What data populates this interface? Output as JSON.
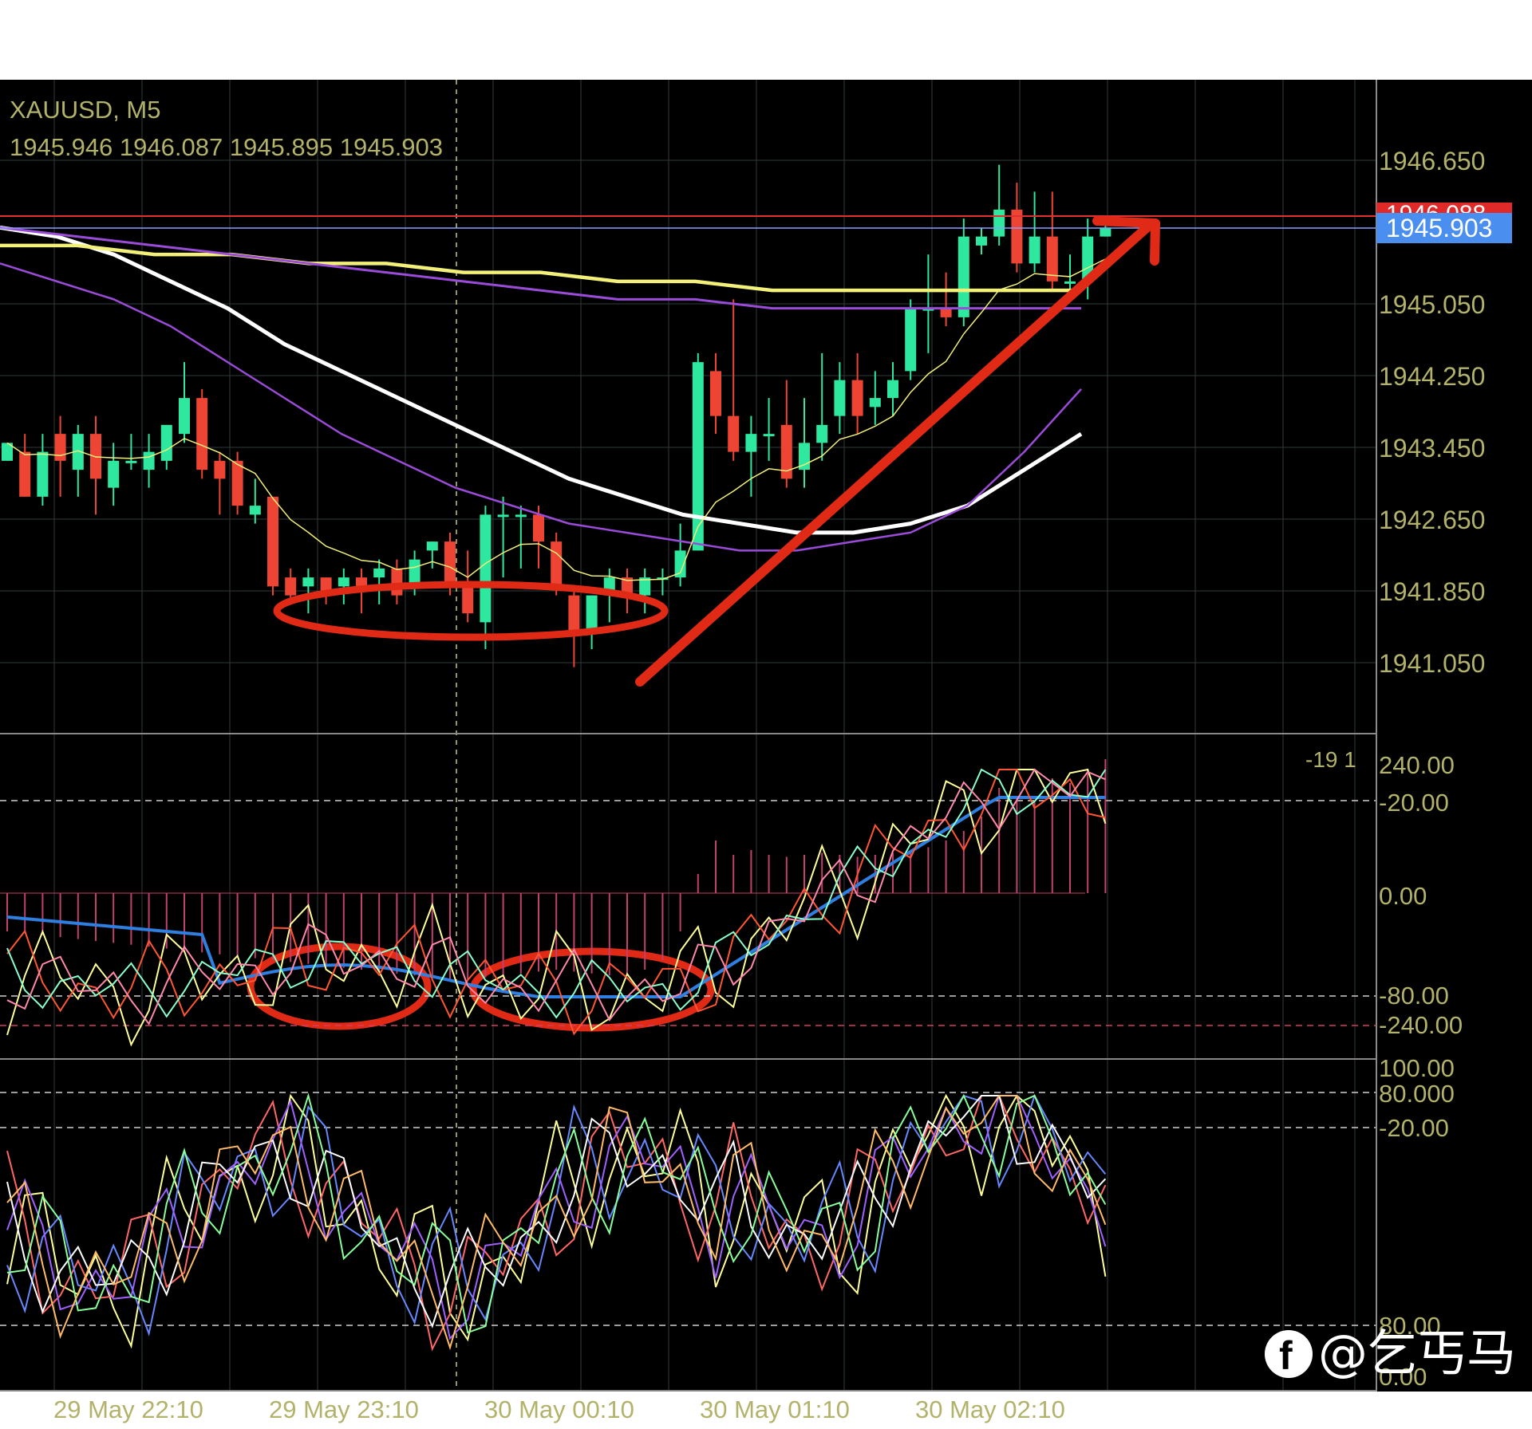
{
  "header": {
    "symbol": "XAUUSD, M5",
    "ohlc": "1945.946 1946.087 1945.895 1945.903"
  },
  "colors": {
    "background": "#000000",
    "grid": "#2f3a3a",
    "axis_text": "#b3b26a",
    "bull": "#2ee8a0",
    "bear": "#ee4433",
    "ask_line": "#e03030",
    "bid_line": "#8aa0ff",
    "price_tag": "#4a8ff0",
    "annotation": "#e02a16",
    "sma_white": "#ffffff",
    "ma_yellow": "#f3f07a",
    "ma_purple": "#9a4bd8",
    "macd_blue": "#2f7fe0"
  },
  "price_tags": {
    "bid": "1945.903",
    "ask_partial": "1946.088"
  },
  "price_axis": {
    "ticks": [
      "1946.650",
      "1945.050",
      "1944.250",
      "1943.450",
      "1942.650",
      "1941.850",
      "1941.050"
    ]
  },
  "osc1_axis": {
    "ticks": [
      "240.00",
      "-20.00",
      "0.00",
      "-80.00",
      "-240.00"
    ],
    "corner_text": "-19 1"
  },
  "osc2_axis": {
    "ticks": [
      "100.00",
      "80.000",
      "-20.00",
      "80.00",
      "0.00"
    ]
  },
  "time_axis": {
    "labels": [
      "29 May 22:10",
      "29 May 23:10",
      "30 May 00:10",
      "30 May 01:10",
      "30 May 02:10"
    ]
  },
  "watermark": {
    "text": "@乞丐马",
    "icon": "facebook-icon"
  },
  "chart_data": {
    "type": "candlestick",
    "title": "XAUUSD, M5",
    "ylim": [
      1940.4,
      1947.2
    ],
    "candles": [
      [
        1943.3,
        1943.5,
        1943.5,
        1943.3
      ],
      [
        1943.4,
        1942.9,
        1943.6,
        1942.9
      ],
      [
        1942.9,
        1943.4,
        1943.6,
        1942.8
      ],
      [
        1943.6,
        1943.3,
        1943.8,
        1942.9
      ],
      [
        1943.2,
        1943.6,
        1943.7,
        1942.9
      ],
      [
        1943.6,
        1943.1,
        1943.8,
        1942.7
      ],
      [
        1943.0,
        1943.3,
        1943.5,
        1942.8
      ],
      [
        1943.3,
        1943.3,
        1943.6,
        1943.2
      ],
      [
        1943.2,
        1943.4,
        1943.6,
        1943.0
      ],
      [
        1943.3,
        1943.7,
        1943.7,
        1943.2
      ],
      [
        1943.6,
        1944.0,
        1944.4,
        1943.5
      ],
      [
        1944.0,
        1943.2,
        1944.1,
        1943.1
      ],
      [
        1943.3,
        1943.1,
        1943.4,
        1942.7
      ],
      [
        1943.3,
        1942.8,
        1943.4,
        1942.7
      ],
      [
        1942.7,
        1942.8,
        1943.1,
        1942.6
      ],
      [
        1942.9,
        1941.9,
        1942.9,
        1941.8
      ],
      [
        1942.0,
        1941.8,
        1942.1,
        1941.7
      ],
      [
        1941.9,
        1942.0,
        1942.1,
        1941.6
      ],
      [
        1942.0,
        1941.8,
        1942.0,
        1941.7
      ],
      [
        1941.9,
        1942.0,
        1942.1,
        1941.7
      ],
      [
        1942.0,
        1941.9,
        1942.1,
        1941.6
      ],
      [
        1942.0,
        1942.1,
        1942.2,
        1941.7
      ],
      [
        1942.1,
        1941.8,
        1942.2,
        1941.7
      ],
      [
        1941.9,
        1942.2,
        1942.3,
        1941.8
      ],
      [
        1942.3,
        1942.4,
        1942.4,
        1942.1
      ],
      [
        1942.4,
        1941.9,
        1942.5,
        1941.8
      ],
      [
        1941.9,
        1941.6,
        1942.3,
        1941.5
      ],
      [
        1941.5,
        1942.7,
        1942.8,
        1941.2
      ],
      [
        1942.7,
        1942.7,
        1942.9,
        1942.0
      ],
      [
        1942.7,
        1942.7,
        1942.8,
        1942.1
      ],
      [
        1942.7,
        1942.4,
        1942.8,
        1942.1
      ],
      [
        1942.4,
        1941.9,
        1942.5,
        1941.8
      ],
      [
        1941.8,
        1941.4,
        1941.9,
        1941.0
      ],
      [
        1941.4,
        1941.8,
        1941.8,
        1941.2
      ],
      [
        1941.8,
        1942.0,
        1942.1,
        1941.5
      ],
      [
        1942.0,
        1941.8,
        1942.1,
        1941.6
      ],
      [
        1941.8,
        1942.0,
        1942.1,
        1941.6
      ],
      [
        1942.0,
        1942.0,
        1942.1,
        1941.8
      ],
      [
        1942.0,
        1942.3,
        1942.6,
        1941.9
      ],
      [
        1942.3,
        1944.4,
        1944.5,
        1942.3
      ],
      [
        1944.3,
        1943.8,
        1944.5,
        1943.6
      ],
      [
        1943.8,
        1943.4,
        1945.1,
        1943.3
      ],
      [
        1943.4,
        1943.6,
        1943.8,
        1942.9
      ],
      [
        1943.6,
        1943.6,
        1944.0,
        1943.3
      ],
      [
        1943.7,
        1943.1,
        1944.2,
        1943.0
      ],
      [
        1943.2,
        1943.5,
        1944.0,
        1943.0
      ],
      [
        1943.5,
        1943.7,
        1944.5,
        1943.3
      ],
      [
        1943.8,
        1944.2,
        1944.4,
        1943.6
      ],
      [
        1944.2,
        1943.8,
        1944.5,
        1943.6
      ],
      [
        1943.9,
        1944.0,
        1944.3,
        1943.7
      ],
      [
        1944.0,
        1944.2,
        1944.4,
        1943.8
      ],
      [
        1944.3,
        1945.0,
        1945.1,
        1944.2
      ],
      [
        1945.0,
        1945.0,
        1945.6,
        1944.5
      ],
      [
        1945.0,
        1944.9,
        1945.4,
        1944.8
      ],
      [
        1944.9,
        1945.8,
        1946.0,
        1944.8
      ],
      [
        1945.7,
        1945.8,
        1945.9,
        1945.6
      ],
      [
        1945.8,
        1946.1,
        1946.6,
        1945.7
      ],
      [
        1946.1,
        1945.5,
        1946.4,
        1945.4
      ],
      [
        1945.5,
        1945.8,
        1946.3,
        1945.4
      ],
      [
        1945.8,
        1945.3,
        1946.3,
        1945.2
      ],
      [
        1945.3,
        1945.3,
        1945.6,
        1945.2
      ],
      [
        1945.3,
        1945.8,
        1946.0,
        1945.1
      ],
      [
        1945.8,
        1945.9,
        1946.0,
        1945.8
      ]
    ],
    "moving_averages": [
      {
        "color": "white",
        "values": [
          1945.9,
          1945.8,
          1945.6,
          1945.3,
          1945.0,
          1944.6,
          1944.3,
          1944.0,
          1943.7,
          1943.4,
          1943.1,
          1942.9,
          1942.7,
          1942.6,
          1942.5,
          1942.5,
          1942.6,
          1942.8,
          1943.2,
          1943.6
        ]
      },
      {
        "color": "purple",
        "values": [
          1945.5,
          1945.3,
          1945.1,
          1944.8,
          1944.4,
          1944.0,
          1943.6,
          1943.3,
          1943.0,
          1942.8,
          1942.6,
          1942.5,
          1942.4,
          1942.3,
          1942.3,
          1942.4,
          1942.5,
          1942.8,
          1943.4,
          1944.1
        ]
      },
      {
        "color": "yellow",
        "values": [
          1945.7,
          1945.7,
          1945.6,
          1945.6,
          1945.5,
          1945.5,
          1945.4,
          1945.4,
          1945.3,
          1945.3,
          1945.2,
          1945.2,
          1945.2,
          1945.2,
          1945.2
        ]
      },
      {
        "color": "purple-slow",
        "values": [
          1945.9,
          1945.8,
          1945.7,
          1945.6,
          1945.5,
          1945.4,
          1945.3,
          1945.2,
          1945.1,
          1945.1,
          1945.0,
          1945.0,
          1945.0,
          1945.0,
          1945.0
        ]
      }
    ]
  }
}
